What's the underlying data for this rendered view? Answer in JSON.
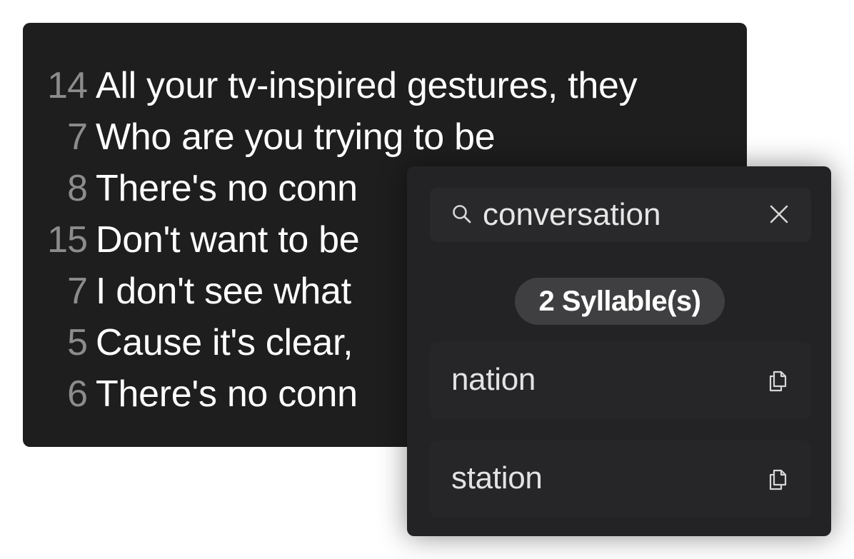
{
  "editor": {
    "lines": [
      {
        "count": "14",
        "text": "All your tv-inspired gestures, they"
      },
      {
        "count": "7",
        "text": "Who are you trying to be"
      },
      {
        "count": "8",
        "text": "There's no conn"
      },
      {
        "count": "15",
        "text": "Don't want to be"
      },
      {
        "count": "7",
        "text": "I don't see what"
      },
      {
        "count": "5",
        "text": "Cause it's clear,"
      },
      {
        "count": "6",
        "text": "There's no conn"
      }
    ]
  },
  "popup": {
    "search": {
      "value": "conversation",
      "search_icon": "search-icon",
      "clear_icon": "close-icon"
    },
    "syllable_badge": "2 Syllable(s)",
    "results": [
      {
        "word": "nation",
        "icon": "copy-icon"
      },
      {
        "word": "station",
        "icon": "copy-icon"
      }
    ]
  }
}
